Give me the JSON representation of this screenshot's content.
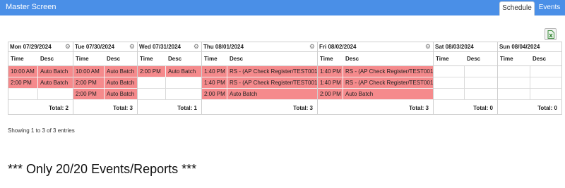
{
  "header": {
    "title": "Master Screen"
  },
  "tabs": [
    {
      "label": "Schedule",
      "active": true
    },
    {
      "label": "Events",
      "active": false
    }
  ],
  "export_icon": "excel-export-icon",
  "colors": {
    "header_bg": "#4a8fe7",
    "busy_cell": "#f58a8c"
  },
  "schedule": {
    "days": [
      {
        "date": "Mon 07/29/2024",
        "time_label": "Time",
        "desc_label": "Desc",
        "rows": [
          {
            "time": "10:00 AM",
            "desc": "Auto Batch"
          },
          {
            "time": "2:00 PM",
            "desc": "Auto Batch"
          },
          {
            "time": "",
            "desc": ""
          }
        ],
        "total": "Total: 2"
      },
      {
        "date": "Tue 07/30/2024",
        "time_label": "Time",
        "desc_label": "Desc",
        "rows": [
          {
            "time": "10:00 AM",
            "desc": "Auto Batch"
          },
          {
            "time": "2:00 PM",
            "desc": "Auto Batch"
          },
          {
            "time": "2:00 PM",
            "desc": "Auto Batch"
          }
        ],
        "total": "Total: 3"
      },
      {
        "date": "Wed 07/31/2024",
        "time_label": "Time",
        "desc_label": "Desc",
        "rows": [
          {
            "time": "2:00 PM",
            "desc": "Auto Batch"
          },
          {
            "time": "",
            "desc": ""
          },
          {
            "time": "",
            "desc": ""
          }
        ],
        "total": "Total: 1"
      },
      {
        "date": "Thu 08/01/2024",
        "time_label": "Time",
        "desc_label": "Desc",
        "rows": [
          {
            "time": "1:40 PM",
            "desc": "RS - (AP Check Register/TEST001)"
          },
          {
            "time": "1:40 PM",
            "desc": "RS - (AP Check Register/TEST001)"
          },
          {
            "time": "2:00 PM",
            "desc": "Auto Batch"
          }
        ],
        "total": "Total: 3"
      },
      {
        "date": "Fri 08/02/2024",
        "time_label": "Time",
        "desc_label": "Desc",
        "rows": [
          {
            "time": "1:40 PM",
            "desc": "RS - (AP Check Register/TEST001)"
          },
          {
            "time": "1:40 PM",
            "desc": "RS - (AP Check Register/TEST001)"
          },
          {
            "time": "2:00 PM",
            "desc": "Auto Batch"
          }
        ],
        "total": "Total: 3"
      },
      {
        "date": "Sat 08/03/2024",
        "time_label": "Time",
        "desc_label": "Desc",
        "rows": [
          {
            "time": "",
            "desc": ""
          },
          {
            "time": "",
            "desc": ""
          },
          {
            "time": "",
            "desc": ""
          }
        ],
        "total": "Total: 0"
      },
      {
        "date": "Sun 08/04/2024",
        "time_label": "Time",
        "desc_label": "Desc",
        "rows": [
          {
            "time": "",
            "desc": ""
          },
          {
            "time": "",
            "desc": ""
          },
          {
            "time": "",
            "desc": ""
          }
        ],
        "total": "Total: 0"
      }
    ]
  },
  "footer": {
    "entries": "Showing 1 to 3 of 3 entries",
    "note": "*** Only 20/20 Events/Reports ***"
  }
}
